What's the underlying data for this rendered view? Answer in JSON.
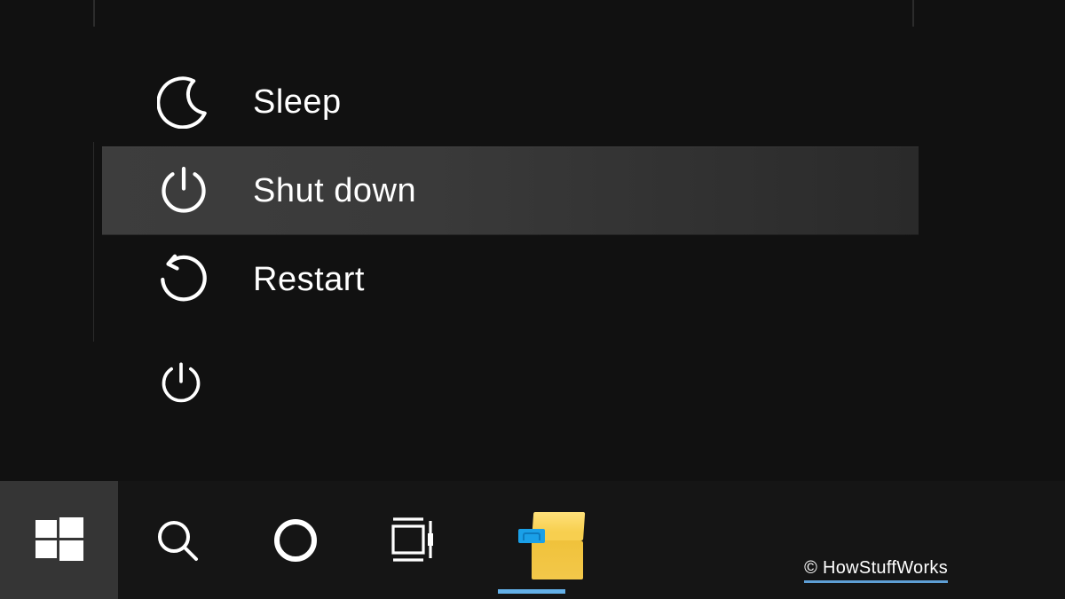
{
  "power_menu": {
    "items": [
      {
        "id": "sleep",
        "label": "Sleep",
        "icon": "moon-icon",
        "highlighted": false
      },
      {
        "id": "shutdown",
        "label": "Shut down",
        "icon": "power-icon",
        "highlighted": true
      },
      {
        "id": "restart",
        "label": "Restart",
        "icon": "restart-icon",
        "highlighted": false
      }
    ]
  },
  "start_rail": {
    "power_button_icon": "power-icon"
  },
  "taskbar": {
    "buttons": [
      {
        "id": "start",
        "icon": "windows-start-icon",
        "active": true
      },
      {
        "id": "search",
        "icon": "search-icon",
        "active": false
      },
      {
        "id": "cortana",
        "icon": "cortana-circle-icon",
        "active": false
      },
      {
        "id": "task-view",
        "icon": "task-view-icon",
        "active": false
      },
      {
        "id": "file-explorer",
        "icon": "file-explorer-icon",
        "active": false,
        "running": true
      }
    ]
  },
  "watermark": {
    "text": "© HowStuffWorks"
  },
  "colors": {
    "background": "#111111",
    "taskbar": "#151515",
    "hover": "#3d3d3d",
    "accent": "#63b0e8",
    "folder_yellow": "#f3c84a",
    "folder_blue": "#1aa0e8"
  }
}
